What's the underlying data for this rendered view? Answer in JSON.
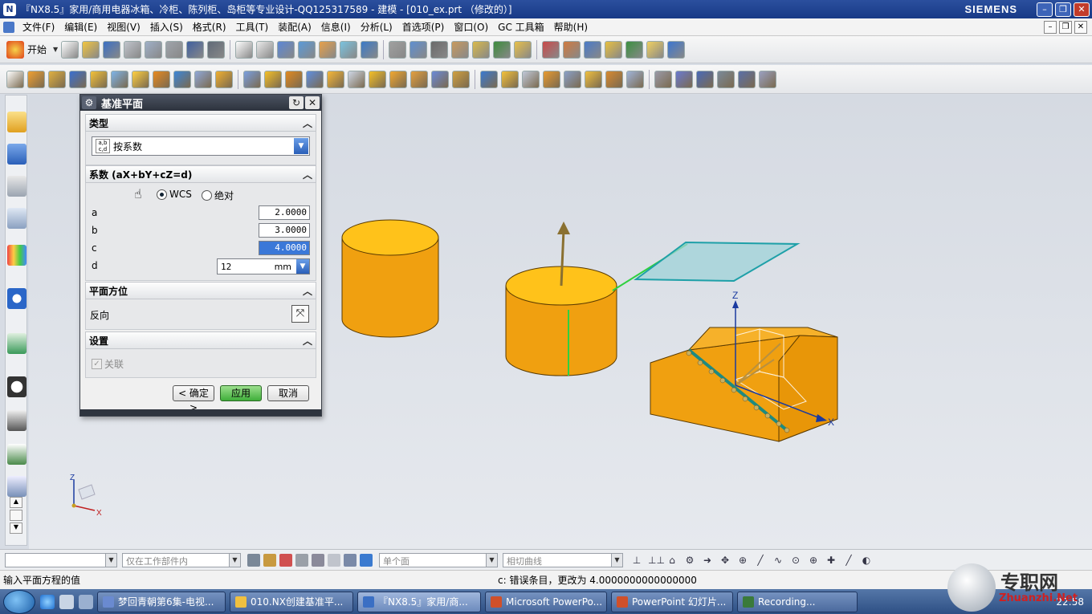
{
  "window": {
    "title": "『NX8.5』家用/商用电器冰箱、冷柜、陈列柜、岛柜等专业设计-QQ125317589 - 建模 - [010_ex.prt （修改的）]",
    "brand": "SIEMENS",
    "app_icon": "nx-app-icon"
  },
  "menu": {
    "items": [
      "文件(F)",
      "编辑(E)",
      "视图(V)",
      "插入(S)",
      "格式(R)",
      "工具(T)",
      "装配(A)",
      "信息(I)",
      "分析(L)",
      "首选项(P)",
      "窗口(O)",
      "GC 工具箱",
      "帮助(H)"
    ]
  },
  "toolbar": {
    "start_label": "开始",
    "standard_icon_colors": [
      "#ffffff",
      "#f2c540",
      "#3a6fc4",
      "#c0c4cc",
      "#9fb0c8",
      "#9fa4ab",
      "#4060a0",
      "#606a78",
      "#ffffff",
      "#eaeaea",
      "#5b87d6",
      "#5a9ad8",
      "#e7a04a",
      "#7ac3df",
      "#3a7ac8",
      "#a0a0a0",
      "#5f8fd0",
      "#6a6a6a",
      "#c89a5e",
      "#d9b94a",
      "#3c8c3c",
      "#e8c04a",
      "#c94a4a",
      "#d07a40",
      "#4a7ac8",
      "#e8c040",
      "#3a9040",
      "#f0d060",
      "#3c76d0"
    ],
    "feature_icon_colors": [
      "#ffffff",
      "#f0a030",
      "#e0b040",
      "#3a6fd0",
      "#f3c23a",
      "#7fb4e8",
      "#ffd040",
      "#e88a20",
      "#3c86d8",
      "#90a8d8",
      "#f0b030",
      "#7a9fe0",
      "#f4c028",
      "#e28a20",
      "#5f8fe0",
      "#f6b838",
      "#cfd7e6",
      "#f4c028",
      "#f2a830",
      "#e4a040",
      "#6a8ad8",
      "#d0a040",
      "#3a7ad0",
      "#f3c23a",
      "#c0c8d8",
      "#e89a30",
      "#8aa0c8",
      "#f0c040",
      "#d88a30",
      "#a0b4d8",
      "#9a9aa8",
      "#6a7ad0",
      "#4a6ab8",
      "#7a8a9a",
      "#5a70a8",
      "#9aa0c0"
    ]
  },
  "dialog": {
    "title": "基准平面",
    "sections": {
      "type": {
        "title": "类型",
        "selected": "按系数"
      },
      "coefficients": {
        "title": "系数 (aX+bY+cZ=d)",
        "radio_wcs": "WCS",
        "radio_absolute": "绝对",
        "a_label": "a",
        "a_value": "2.0000",
        "b_label": "b",
        "b_value": "3.0000",
        "c_label": "c",
        "c_value": "4.0000",
        "d_label": "d",
        "d_value": "12",
        "d_unit": "mm"
      },
      "orientation": {
        "title": "平面方位",
        "reverse_label": "反向"
      },
      "settings": {
        "title": "设置",
        "associative_label": "关联"
      }
    },
    "buttons": {
      "ok": "< 确定 >",
      "apply": "应用",
      "cancel": "取消"
    }
  },
  "viewport": {
    "axis_z": "Z",
    "axis_x": "X",
    "triad_z": "Z",
    "triad_x": "X",
    "colors": {
      "solid": "#f0a010",
      "solid_top": "#ffc21a",
      "plane": "#9fd3d8",
      "plane_edge": "#1ea0a8",
      "green_edge": "#30d040"
    }
  },
  "selection_bar": {
    "filter_placeholder": "",
    "scope": "仅在工作部件内",
    "face_rule": "单个面",
    "curve_rule": "相切曲线"
  },
  "status": {
    "prompt": "输入平面方程的值",
    "message": "c: 错误条目，更改为 4.0000000000000000"
  },
  "taskbar": {
    "items": [
      {
        "label": "梦回青朝第6集-电视...",
        "icon_color": "#6a8ad0"
      },
      {
        "label": "010.NX创建基准平...",
        "icon_color": "#f0c040"
      },
      {
        "label": "『NX8.5』家用/商...",
        "icon_color": "#3a6fc4"
      },
      {
        "label": "Microsoft PowerPo...",
        "icon_color": "#d0502a"
      },
      {
        "label": "PowerPoint 幻灯片...",
        "icon_color": "#d0502a"
      },
      {
        "label": "Recording...",
        "icon_color": "#3a7a3a"
      }
    ],
    "clock": "22:58"
  },
  "watermark": {
    "text": "专职网",
    "subtext": "Zhuanzhi.Net"
  }
}
